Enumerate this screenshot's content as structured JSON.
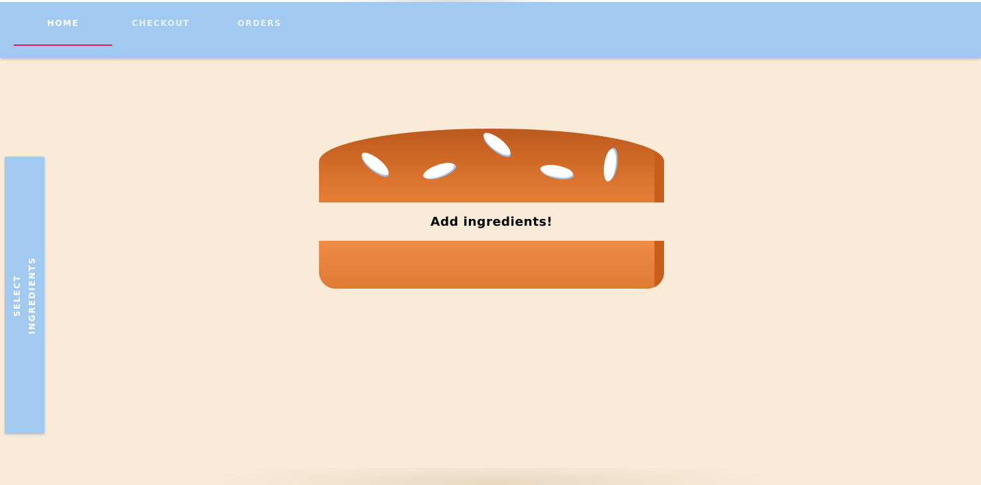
{
  "nav": {
    "tabs": [
      {
        "label": "HOME",
        "active": true
      },
      {
        "label": "CHECKOUT",
        "active": false
      },
      {
        "label": "ORDERS",
        "active": false
      }
    ],
    "active_indicator_color": "#e6195a",
    "background_color": "#a2c9f0"
  },
  "side_panel": {
    "label": "SELECT INGREDIENTS"
  },
  "burger": {
    "message": "Add ingredients!",
    "bun_color": "#e07a35",
    "seed_icon": "sesame-seed-icon"
  },
  "colors": {
    "page_background": "#faebd9",
    "accent": "#a2c9f0"
  }
}
